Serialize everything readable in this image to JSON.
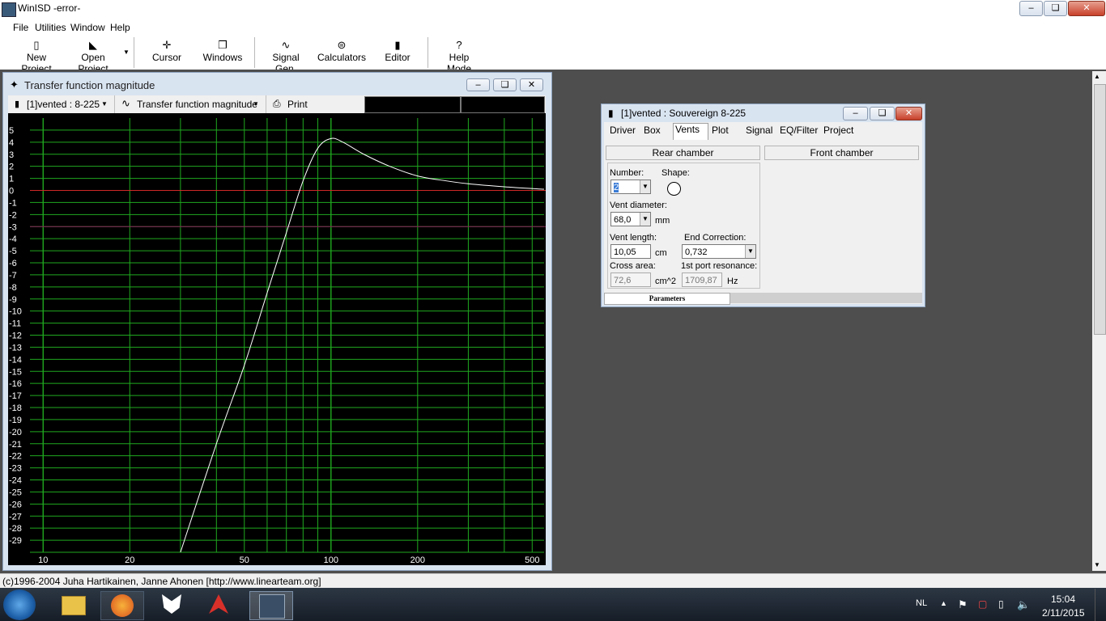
{
  "window": {
    "title": "WinISD -error-"
  },
  "menu": [
    "File",
    "Utilities",
    "Window",
    "Help"
  ],
  "toolbar": [
    {
      "label": "New Project",
      "icon": "document-icon"
    },
    {
      "label": "Open Project",
      "icon": "folder-open-icon"
    },
    {
      "label": "Cursor",
      "icon": "crosshair-icon"
    },
    {
      "label": "Windows",
      "icon": "windows-icon"
    },
    {
      "label": "Signal Gen.",
      "icon": "sine-wave-icon"
    },
    {
      "label": "Calculators",
      "icon": "calculator-icon"
    },
    {
      "label": "Editor",
      "icon": "editor-icon"
    },
    {
      "label": "Help Mode",
      "icon": "question-icon"
    }
  ],
  "graph": {
    "title": "Transfer function magnitude",
    "project_select": "[1]vented : 8-225",
    "graph_select": "Transfer function magnitude",
    "print_label": "Print"
  },
  "vent_window": {
    "title": "[1]vented : Souvereign 8-225",
    "tabs": [
      "Driver",
      "Box",
      "Vents",
      "Plot",
      "Signal",
      "EQ/Filter",
      "Project"
    ],
    "active_tab": "Vents",
    "rear_chamber": "Rear chamber",
    "front_chamber": "Front chamber",
    "number_label": "Number:",
    "number_value": "2",
    "shape_label": "Shape:",
    "vent_diameter_label": "Vent diameter:",
    "vent_diameter_value": "68,0",
    "vent_diameter_unit": "mm",
    "vent_length_label": "Vent length:",
    "vent_length_value": "10,05",
    "vent_length_unit": "cm",
    "end_correction_label": "End Correction:",
    "end_correction_value": "0,732",
    "cross_area_label": "Cross area:",
    "cross_area_value": "72,6",
    "cross_area_unit": "cm^2",
    "resonance_label": "1st port resonance:",
    "resonance_value": "1709,87",
    "resonance_unit": "Hz",
    "bottom_tab": "Parameters"
  },
  "status": "(c)1996-2004 Juha Hartikainen, Janne Ahonen [http://www.linearteam.org]",
  "taskbar": {
    "lang": "NL",
    "time": "15:04",
    "date": "2/11/2015"
  },
  "chart_data": {
    "type": "line",
    "title": "Transfer function magnitude",
    "xscale": "log",
    "xlim": [
      9,
      550
    ],
    "ylim": [
      -30,
      6
    ],
    "xticks": [
      10,
      20,
      50,
      100,
      200,
      500
    ],
    "yticks": [
      5,
      4,
      3,
      2,
      1,
      0,
      -1,
      -2,
      -3,
      -4,
      -5,
      -6,
      -7,
      -8,
      -9,
      -10,
      -11,
      -12,
      -13,
      -14,
      -15,
      -16,
      -17,
      -18,
      -19,
      -20,
      -21,
      -22,
      -23,
      -24,
      -25,
      -26,
      -27,
      -28,
      -29
    ],
    "reference_lines": [
      0,
      -3
    ],
    "grid": true,
    "series": [
      {
        "x": [
          30,
          40,
          50,
          60,
          70,
          80,
          90,
          100,
          110,
          130,
          160,
          200,
          250,
          300,
          400,
          550
        ],
        "y": [
          -30,
          -21,
          -14.5,
          -8.5,
          -3.5,
          0.8,
          3.5,
          4.3,
          4.0,
          3.0,
          2.0,
          1.2,
          0.8,
          0.55,
          0.3,
          0.1
        ]
      }
    ]
  }
}
